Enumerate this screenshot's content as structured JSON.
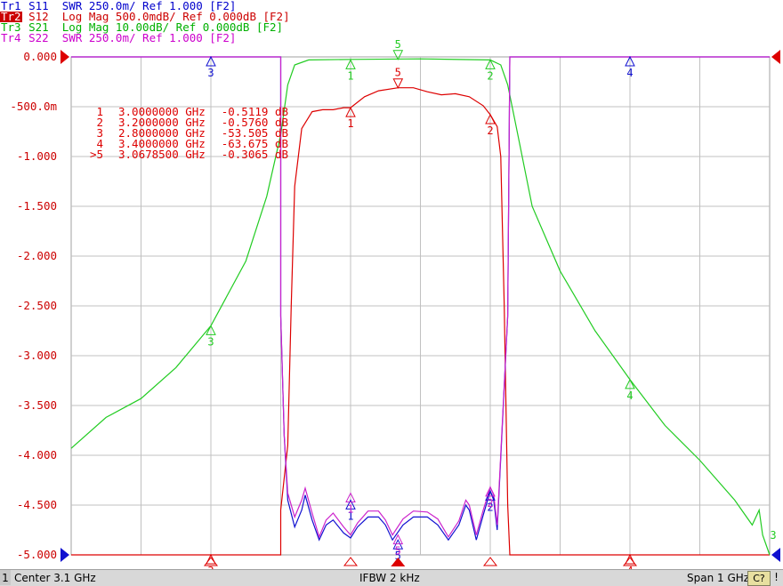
{
  "traces": [
    {
      "id": "Tr1",
      "text": "S11  SWR 250.0m/ Ref 1.000 [F2]",
      "color": "#0000cc",
      "active": false
    },
    {
      "id": "Tr2",
      "text": "S12  Log Mag 500.0mdB/ Ref 0.000dB [F2]",
      "color": "#cc0000",
      "active": true
    },
    {
      "id": "Tr3",
      "text": "S21  Log Mag 10.00dB/ Ref 0.000dB [F2]",
      "color": "#00b000",
      "active": false
    },
    {
      "id": "Tr4",
      "text": "S22  SWR 250.0m/ Ref 1.000 [F2]",
      "color": "#cc00cc",
      "active": false
    }
  ],
  "colors": {
    "tr1": "#1010d0",
    "tr2": "#dd0000",
    "tr3": "#22cc22",
    "tr4": "#cc22cc",
    "grid": "#c0c0c0",
    "axis_text": "#cc0000"
  },
  "marker_table": [
    {
      "label": "1",
      "freq": "3.0000000 GHz",
      "value": "-0.5119 dB"
    },
    {
      "label": "2",
      "freq": "3.2000000 GHz",
      "value": "-0.5760 dB"
    },
    {
      "label": "3",
      "freq": "2.8000000 GHz",
      "value": "-53.505 dB"
    },
    {
      "label": "4",
      "freq": "3.4000000 GHz",
      "value": "-63.675 dB"
    },
    {
      "label": ">5",
      "freq": "3.0678500 GHz",
      "value": "-0.3065 dB"
    }
  ],
  "status": {
    "channel": "1",
    "center": "Center 3.1 GHz",
    "ifbw": "IFBW 2 kHz",
    "span": "Span 1 GHz",
    "cal": "C?",
    "warn": "!"
  },
  "chart_data": {
    "type": "line",
    "x_unit": "GHz",
    "xlim": [
      2.6,
      3.6
    ],
    "ylim": [
      -5.0,
      0.0
    ],
    "y_ticks": [
      "0.000",
      "-500.0m",
      "-1.000",
      "-1.500",
      "-2.000",
      "-2.500",
      "-3.000",
      "-3.500",
      "-4.000",
      "-4.500",
      "-5.000"
    ],
    "grid": true,
    "series": [
      {
        "name": "Tr2 S12 Log Mag",
        "color": "#dd0000",
        "points": [
          [
            2.6,
            -5.0
          ],
          [
            2.8,
            -5.0
          ],
          [
            2.9,
            -5.0
          ],
          [
            2.9,
            -4.55
          ],
          [
            2.91,
            -3.9
          ],
          [
            2.915,
            -2.5
          ],
          [
            2.92,
            -1.3
          ],
          [
            2.93,
            -0.72
          ],
          [
            2.945,
            -0.55
          ],
          [
            2.96,
            -0.53
          ],
          [
            2.975,
            -0.53
          ],
          [
            2.99,
            -0.51
          ],
          [
            3.0,
            -0.51
          ],
          [
            3.02,
            -0.4
          ],
          [
            3.04,
            -0.34
          ],
          [
            3.068,
            -0.31
          ],
          [
            3.09,
            -0.31
          ],
          [
            3.11,
            -0.35
          ],
          [
            3.13,
            -0.38
          ],
          [
            3.15,
            -0.37
          ],
          [
            3.17,
            -0.4
          ],
          [
            3.19,
            -0.49
          ],
          [
            3.2,
            -0.58
          ],
          [
            3.21,
            -0.7
          ],
          [
            3.215,
            -1.0
          ],
          [
            3.22,
            -2.5
          ],
          [
            3.225,
            -4.5
          ],
          [
            3.228,
            -5.0
          ],
          [
            3.6,
            -5.0
          ]
        ]
      },
      {
        "name": "Tr3 S21 Log Mag",
        "color": "#22cc22",
        "points": [
          [
            2.6,
            -3.93
          ],
          [
            2.65,
            -3.62
          ],
          [
            2.7,
            -3.43
          ],
          [
            2.75,
            -3.12
          ],
          [
            2.8,
            -2.7
          ],
          [
            2.85,
            -2.05
          ],
          [
            2.88,
            -1.4
          ],
          [
            2.9,
            -0.78
          ],
          [
            2.91,
            -0.28
          ],
          [
            2.92,
            -0.08
          ],
          [
            2.94,
            -0.03
          ],
          [
            3.0,
            -0.025
          ],
          [
            3.1,
            -0.02
          ],
          [
            3.2,
            -0.03
          ],
          [
            3.215,
            -0.08
          ],
          [
            3.225,
            -0.28
          ],
          [
            3.24,
            -0.8
          ],
          [
            3.26,
            -1.5
          ],
          [
            3.3,
            -2.15
          ],
          [
            3.35,
            -2.75
          ],
          [
            3.4,
            -3.24
          ],
          [
            3.45,
            -3.7
          ],
          [
            3.5,
            -4.05
          ],
          [
            3.55,
            -4.45
          ],
          [
            3.575,
            -4.7
          ],
          [
            3.585,
            -4.55
          ],
          [
            3.59,
            -4.8
          ],
          [
            3.6,
            -5.0
          ]
        ]
      },
      {
        "name": "Tr1 S11 SWR",
        "color": "#1010d0",
        "points": [
          [
            2.6,
            0.0
          ],
          [
            2.9,
            0.0
          ],
          [
            2.9,
            -2.6
          ],
          [
            2.905,
            -3.8
          ],
          [
            2.91,
            -4.45
          ],
          [
            2.92,
            -4.72
          ],
          [
            2.93,
            -4.55
          ],
          [
            2.935,
            -4.4
          ],
          [
            2.945,
            -4.65
          ],
          [
            2.955,
            -4.85
          ],
          [
            2.965,
            -4.7
          ],
          [
            2.975,
            -4.65
          ],
          [
            2.99,
            -4.78
          ],
          [
            3.0,
            -4.83
          ],
          [
            3.01,
            -4.72
          ],
          [
            3.025,
            -4.62
          ],
          [
            3.04,
            -4.62
          ],
          [
            3.05,
            -4.7
          ],
          [
            3.06,
            -4.85
          ],
          [
            3.075,
            -4.7
          ],
          [
            3.09,
            -4.62
          ],
          [
            3.11,
            -4.62
          ],
          [
            3.125,
            -4.7
          ],
          [
            3.14,
            -4.85
          ],
          [
            3.155,
            -4.7
          ],
          [
            3.165,
            -4.5
          ],
          [
            3.17,
            -4.55
          ],
          [
            3.18,
            -4.85
          ],
          [
            3.19,
            -4.6
          ],
          [
            3.2,
            -4.36
          ],
          [
            3.205,
            -4.45
          ],
          [
            3.21,
            -4.75
          ],
          [
            3.225,
            -2.6
          ],
          [
            3.228,
            0.0
          ],
          [
            3.6,
            0.0
          ]
        ]
      },
      {
        "name": "Tr4 S22 SWR",
        "color": "#cc22cc",
        "points": [
          [
            2.6,
            0.0
          ],
          [
            2.9,
            0.0
          ],
          [
            2.9,
            -2.6
          ],
          [
            2.905,
            -3.8
          ],
          [
            2.91,
            -4.38
          ],
          [
            2.92,
            -4.62
          ],
          [
            2.93,
            -4.45
          ],
          [
            2.935,
            -4.33
          ],
          [
            2.945,
            -4.58
          ],
          [
            2.955,
            -4.82
          ],
          [
            2.965,
            -4.65
          ],
          [
            2.975,
            -4.58
          ],
          [
            2.99,
            -4.72
          ],
          [
            3.0,
            -4.8
          ],
          [
            3.01,
            -4.68
          ],
          [
            3.025,
            -4.56
          ],
          [
            3.04,
            -4.56
          ],
          [
            3.05,
            -4.65
          ],
          [
            3.06,
            -4.8
          ],
          [
            3.075,
            -4.64
          ],
          [
            3.09,
            -4.56
          ],
          [
            3.11,
            -4.57
          ],
          [
            3.125,
            -4.64
          ],
          [
            3.14,
            -4.82
          ],
          [
            3.155,
            -4.66
          ],
          [
            3.165,
            -4.45
          ],
          [
            3.17,
            -4.5
          ],
          [
            3.18,
            -4.8
          ],
          [
            3.19,
            -4.55
          ],
          [
            3.2,
            -4.32
          ],
          [
            3.205,
            -4.4
          ],
          [
            3.21,
            -4.7
          ],
          [
            3.225,
            -2.6
          ],
          [
            3.228,
            0.0
          ],
          [
            3.6,
            0.0
          ]
        ]
      }
    ],
    "markers": [
      {
        "trace": "Tr1",
        "label": "3",
        "x": 2.8,
        "y": 0.0,
        "color": "#1010d0",
        "dir": "up"
      },
      {
        "trace": "Tr1",
        "label": "4",
        "x": 3.4,
        "y": 0.0,
        "color": "#1010d0",
        "dir": "up"
      },
      {
        "trace": "Tr1",
        "label": "1",
        "x": 3.0,
        "y": -4.45,
        "color": "#1010d0",
        "dir": "up"
      },
      {
        "trace": "Tr1",
        "label": "2",
        "x": 3.2,
        "y": -4.36,
        "color": "#1010d0",
        "dir": "up"
      },
      {
        "trace": "Tr1",
        "label": "5",
        "x": 3.0679,
        "y": -4.85,
        "color": "#1010d0",
        "dir": "up"
      },
      {
        "trace": "Tr4",
        "label": "1",
        "x": 3.0,
        "y": -4.38,
        "color": "#cc22cc",
        "dir": "up"
      },
      {
        "trace": "Tr4",
        "label": "2",
        "x": 3.2,
        "y": -4.32,
        "color": "#cc22cc",
        "dir": "up"
      },
      {
        "trace": "Tr4",
        "label": "5",
        "x": 3.0679,
        "y": -4.8,
        "color": "#cc22cc",
        "dir": "up"
      },
      {
        "trace": "Tr3",
        "label": "1",
        "x": 3.0,
        "y": -0.03,
        "color": "#22cc22",
        "dir": "up"
      },
      {
        "trace": "Tr3",
        "label": "2",
        "x": 3.2,
        "y": -0.03,
        "color": "#22cc22",
        "dir": "up"
      },
      {
        "trace": "Tr3",
        "label": "5",
        "x": 3.0679,
        "y": -0.025,
        "color": "#22cc22",
        "dir": "down"
      },
      {
        "trace": "Tr3",
        "label": "3",
        "x": 2.8,
        "y": -2.7,
        "color": "#22cc22",
        "dir": "up"
      },
      {
        "trace": "Tr3",
        "label": "4",
        "x": 3.4,
        "y": -3.24,
        "color": "#22cc22",
        "dir": "up"
      },
      {
        "trace": "Tr3",
        "label": "3",
        "x": 3.6,
        "y": -5.0,
        "color": "#22cc22",
        "dir": "none"
      },
      {
        "trace": "Tr2",
        "label": "1",
        "x": 3.0,
        "y": -0.51,
        "color": "#dd0000",
        "dir": "up"
      },
      {
        "trace": "Tr2",
        "label": "2",
        "x": 3.2,
        "y": -0.58,
        "color": "#dd0000",
        "dir": "up"
      },
      {
        "trace": "Tr2",
        "label": "5",
        "x": 3.0679,
        "y": -0.31,
        "color": "#dd0000",
        "dir": "down"
      },
      {
        "trace": "Tr2",
        "label": "3",
        "x": 2.8,
        "y": -5.0,
        "color": "#dd0000",
        "dir": "up"
      },
      {
        "trace": "Tr2",
        "label": "4",
        "x": 3.4,
        "y": -5.0,
        "color": "#dd0000",
        "dir": "up"
      }
    ]
  }
}
